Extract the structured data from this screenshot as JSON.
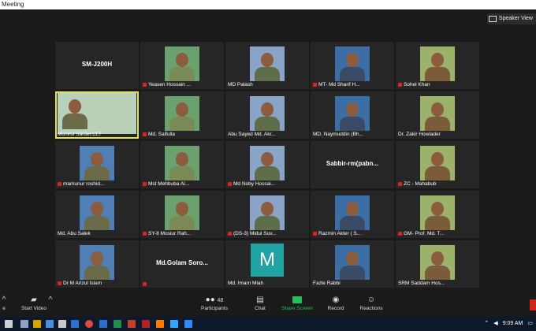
{
  "window": {
    "title": "Meeting"
  },
  "view_button": {
    "label": "Speaker View"
  },
  "tiles": [
    {
      "name": "",
      "big_label": "SM-J200H",
      "muted": false
    },
    {
      "name": "Yeasen Hossain ...",
      "muted": true
    },
    {
      "name": "MD Palash",
      "muted": false
    },
    {
      "name": "MT- Md Sharif H...",
      "muted": true
    },
    {
      "name": "Sohel Khan",
      "muted": true
    },
    {
      "name": "Monirul Sarder.CLT",
      "muted": false,
      "active": true
    },
    {
      "name": "Md. Saifulla",
      "muted": true
    },
    {
      "name": "Abu Sayed Md. Akr...",
      "muted": false
    },
    {
      "name": "MD. Naymuddin (Bh...",
      "muted": false
    },
    {
      "name": "Dr. Zakir Howlader",
      "muted": false
    },
    {
      "name": "mamunur roshid...",
      "muted": true
    },
    {
      "name": "Mst Mehbuba Al...",
      "muted": true
    },
    {
      "name": "Md Noby Hossai...",
      "muted": true
    },
    {
      "name": "",
      "big_label": "Sabbir-rm(pabn...",
      "muted": false
    },
    {
      "name": "ZC - Mahabub",
      "muted": true
    },
    {
      "name": "Md. Abu Salek",
      "muted": false
    },
    {
      "name": "SY-8 Mosiur Rah...",
      "muted": true
    },
    {
      "name": "(DS-3) Midul Suv...",
      "muted": true
    },
    {
      "name": "Razmin Akter ( S...",
      "muted": true
    },
    {
      "name": "GM- Prof. Md. T...",
      "muted": true
    },
    {
      "name": "Dr M Arizul Islam",
      "muted": true
    },
    {
      "name": "",
      "big_label": "Md.Golam Soro...",
      "muted": true
    },
    {
      "name": "Md. Imarn Miah",
      "muted": false,
      "avatar_letter": "M"
    },
    {
      "name": "Fazle Rabbi",
      "muted": false
    },
    {
      "name": "SRM Saddam Hos...",
      "muted": false
    }
  ],
  "toolbar": {
    "leave_partial": "e",
    "start_video": "Start Video",
    "participants_label": "Participants",
    "participants_count": "48",
    "chat": "Chat",
    "share_screen": "Share Screen",
    "record": "Record",
    "reactions": "Reactions"
  },
  "taskbar": {
    "time": "9:09 AM"
  },
  "colors": {
    "share": "#23c15a",
    "active_border": "#e0e26a",
    "mute": "#d22222"
  }
}
